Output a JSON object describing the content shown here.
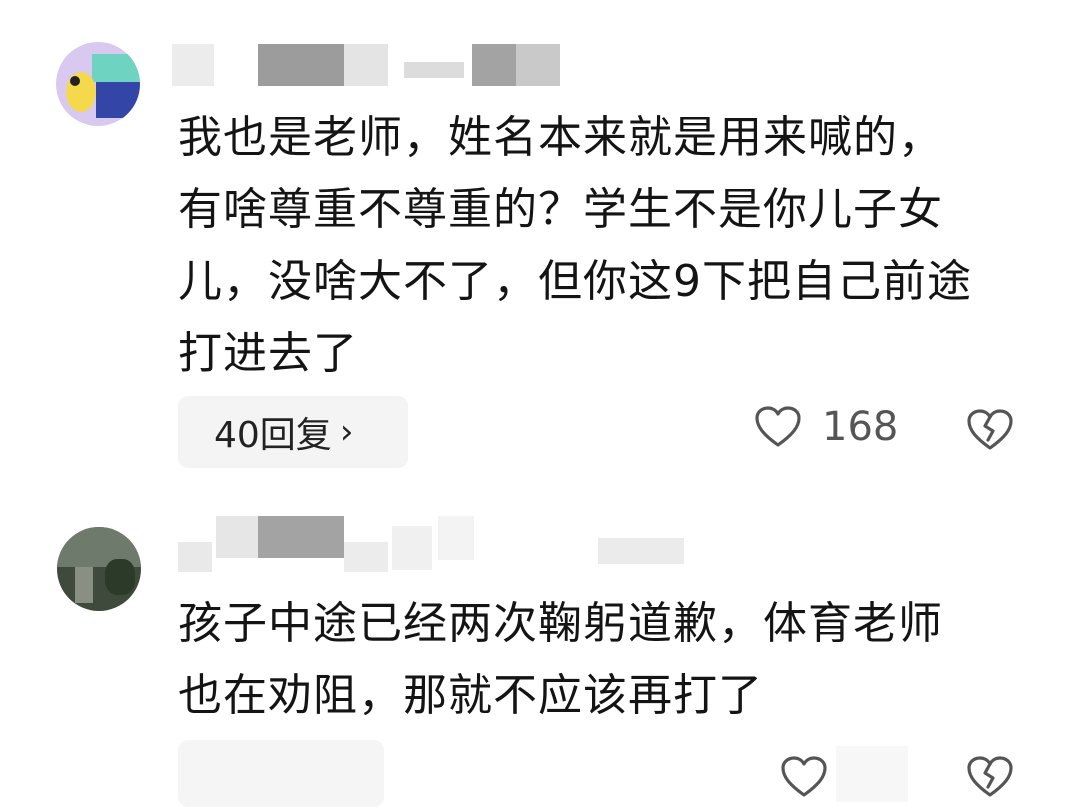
{
  "comments": [
    {
      "text_lines": [
        "我也是老师，姓名本来就是用来喊的，",
        "有啥尊重不尊重的？学生不是你儿子女",
        "儿，没啥大不了，但你这9下把自己前途",
        "打进去了"
      ],
      "reply_button": "40回复",
      "reply_chevron": "›",
      "like_count": "168",
      "like_icon": "heart-outline-icon",
      "dislike_icon": "broken-heart-icon"
    },
    {
      "text_lines": [
        "孩子中途已经两次鞠躬道歉，体育老师",
        "也在劝阻，那就不应该再打了"
      ],
      "like_icon": "heart-outline-icon",
      "dislike_icon": "broken-heart-icon"
    }
  ],
  "colors": {
    "text": "#141414",
    "meta": "#555555",
    "pill_bg": "#f4f4f4",
    "icon": "#555555"
  }
}
